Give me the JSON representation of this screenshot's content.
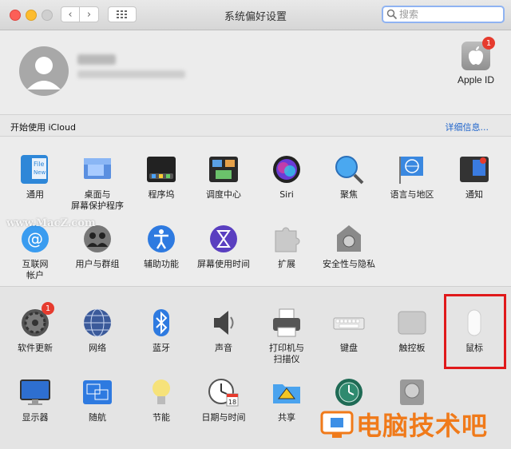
{
  "window": {
    "title": "系统偏好设置"
  },
  "search": {
    "placeholder": "搜索"
  },
  "account": {
    "apple_id_label": "Apple ID",
    "apple_id_badge": "1",
    "icloud_prompt": "开始使用 iCloud",
    "details_link": "详细信息..."
  },
  "row1": [
    {
      "label": "通用",
      "icon": "general-icon"
    },
    {
      "label": "桌面与\n屏幕保护程序",
      "icon": "desktop-icon"
    },
    {
      "label": "程序坞",
      "icon": "dock-icon"
    },
    {
      "label": "调度中心",
      "icon": "mission-control-icon"
    },
    {
      "label": "Siri",
      "icon": "siri-icon"
    },
    {
      "label": "聚焦",
      "icon": "spotlight-icon"
    },
    {
      "label": "语言与地区",
      "icon": "language-region-icon"
    },
    {
      "label": "通知",
      "icon": "notifications-icon"
    }
  ],
  "row2": [
    {
      "label": "互联网\n帐户",
      "icon": "internet-accounts-icon"
    },
    {
      "label": "用户与群组",
      "icon": "users-groups-icon"
    },
    {
      "label": "辅助功能",
      "icon": "accessibility-icon"
    },
    {
      "label": "屏幕使用时间",
      "icon": "screen-time-icon"
    },
    {
      "label": "扩展",
      "icon": "extensions-icon"
    },
    {
      "label": "安全性与隐私",
      "icon": "security-privacy-icon"
    }
  ],
  "row3": [
    {
      "label": "软件更新",
      "icon": "software-update-icon",
      "badge": "1"
    },
    {
      "label": "网络",
      "icon": "network-icon"
    },
    {
      "label": "蓝牙",
      "icon": "bluetooth-icon"
    },
    {
      "label": "声音",
      "icon": "sound-icon"
    },
    {
      "label": "打印机与\n扫描仪",
      "icon": "printer-icon"
    },
    {
      "label": "键盘",
      "icon": "keyboard-icon"
    },
    {
      "label": "触控板",
      "icon": "trackpad-icon"
    },
    {
      "label": "鼠标",
      "icon": "mouse-icon"
    }
  ],
  "row4": [
    {
      "label": "显示器",
      "icon": "displays-icon"
    },
    {
      "label": "随航",
      "icon": "sidecar-icon"
    },
    {
      "label": "节能",
      "icon": "energy-saver-icon"
    },
    {
      "label": "日期与时间",
      "icon": "date-time-icon",
      "day": "18"
    },
    {
      "label": "共享",
      "icon": "sharing-icon"
    },
    {
      "label": "",
      "icon": "time-machine-icon"
    },
    {
      "label": "",
      "icon": "startup-disk-icon"
    }
  ],
  "watermarks": {
    "site": "www.MacZ.com",
    "brand": "电脑技术吧"
  },
  "colors": {
    "accent": "#2266cc",
    "badge": "#e63b2e",
    "highlight": "#e0191b"
  }
}
